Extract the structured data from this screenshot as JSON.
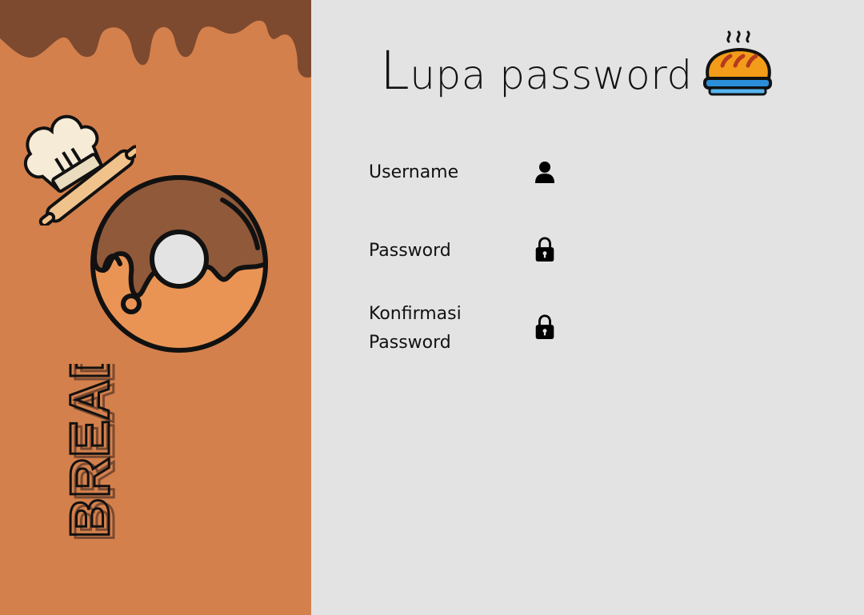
{
  "brand": {
    "word": "BREAD"
  },
  "form": {
    "title_first": "L",
    "title_rest": "upa password",
    "fields": [
      {
        "label": "Username",
        "icon": "user-icon",
        "value": ""
      },
      {
        "label": "Password",
        "icon": "lock-icon",
        "value": ""
      },
      {
        "label_line1": "Konfirmasi",
        "label_line2": "Password",
        "icon": "lock-icon",
        "value": ""
      }
    ]
  },
  "colors": {
    "left_panel": "#d4804c",
    "chocolate": "#7d4a30",
    "right_panel": "#e3e3e3",
    "text": "#111111"
  }
}
